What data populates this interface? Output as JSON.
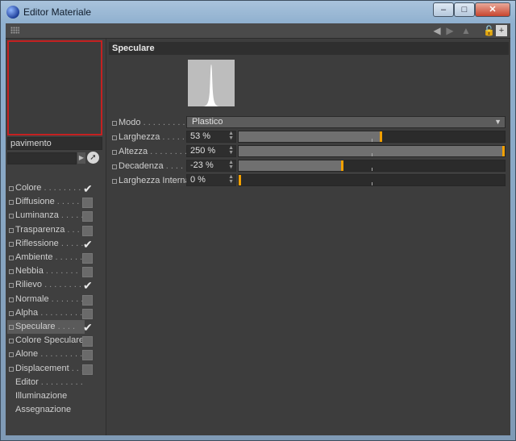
{
  "window": {
    "title": "Editor Materiale",
    "buttons": {
      "minimize": "–",
      "maximize": "□",
      "close": "✕"
    }
  },
  "toolbar": {
    "icons": [
      "back-arrow-icon",
      "forward-arrow-icon",
      "up-arrow-icon",
      "lock-icon",
      "new-window-icon"
    ]
  },
  "material": {
    "name": "pavimento"
  },
  "channels": [
    {
      "label": "Colore",
      "dots": " . . . . . . . . .",
      "checked": true,
      "has_checkbox": true
    },
    {
      "label": "Diffusione",
      "dots": " . . . . .",
      "checked": false,
      "has_checkbox": true
    },
    {
      "label": "Luminanza",
      "dots": " . . . . .",
      "checked": false,
      "has_checkbox": true
    },
    {
      "label": "Trasparenza",
      "dots": " . . . .",
      "checked": false,
      "has_checkbox": true
    },
    {
      "label": "Riflessione",
      "dots": " . . . . .",
      "checked": true,
      "has_checkbox": true
    },
    {
      "label": "Ambiente",
      "dots": " . . . . . .",
      "checked": false,
      "has_checkbox": true
    },
    {
      "label": "Nebbia",
      "dots": " . . . . . . .",
      "checked": false,
      "has_checkbox": true
    },
    {
      "label": "Rilievo",
      "dots": " . . . . . . . .",
      "checked": true,
      "has_checkbox": true
    },
    {
      "label": "Normale",
      "dots": " . . . . . . .",
      "checked": false,
      "has_checkbox": true
    },
    {
      "label": "Alpha",
      "dots": " . . . . . . . . .",
      "checked": false,
      "has_checkbox": true
    },
    {
      "label": "Speculare",
      "dots": " . . . .",
      "checked": true,
      "has_checkbox": true,
      "selected": true
    },
    {
      "label": "Colore Speculare",
      "dots": "",
      "checked": false,
      "has_checkbox": true
    },
    {
      "label": "Alone",
      "dots": " . . . . . . . . .",
      "checked": false,
      "has_checkbox": true
    },
    {
      "label": "Displacement",
      "dots": " . . .",
      "checked": false,
      "has_checkbox": true
    },
    {
      "label": "Editor",
      "dots": " . . . . . . . . .",
      "has_checkbox": false
    },
    {
      "label": "Illuminazione",
      "dots": "",
      "has_checkbox": false
    },
    {
      "label": "Assegnazione",
      "dots": "",
      "has_checkbox": false
    }
  ],
  "specular": {
    "title": "Speculare",
    "mode": {
      "label": "Modo",
      "dots": " . . . . . . . . .",
      "value": "Plastico"
    },
    "params": [
      {
        "label": "Larghezza",
        "dots": " . . . . .",
        "value": "53 %",
        "fraction": 0.53,
        "tick": 0.5
      },
      {
        "label": "Altezza",
        "dots": " . . . . . . . .",
        "value": "250 %",
        "fraction": 1.0,
        "tick": 0.5
      },
      {
        "label": "Decadenza",
        "dots": " . . . .",
        "value": "-23 %",
        "fraction": 0.385,
        "tick": 0.5
      },
      {
        "label": "Larghezza Interna",
        "dots": "",
        "value": "0 %",
        "fraction": 0.0,
        "tick": 0.5
      }
    ]
  },
  "colors": {
    "accent": "#f2a000",
    "preview_border": "#c42121"
  }
}
